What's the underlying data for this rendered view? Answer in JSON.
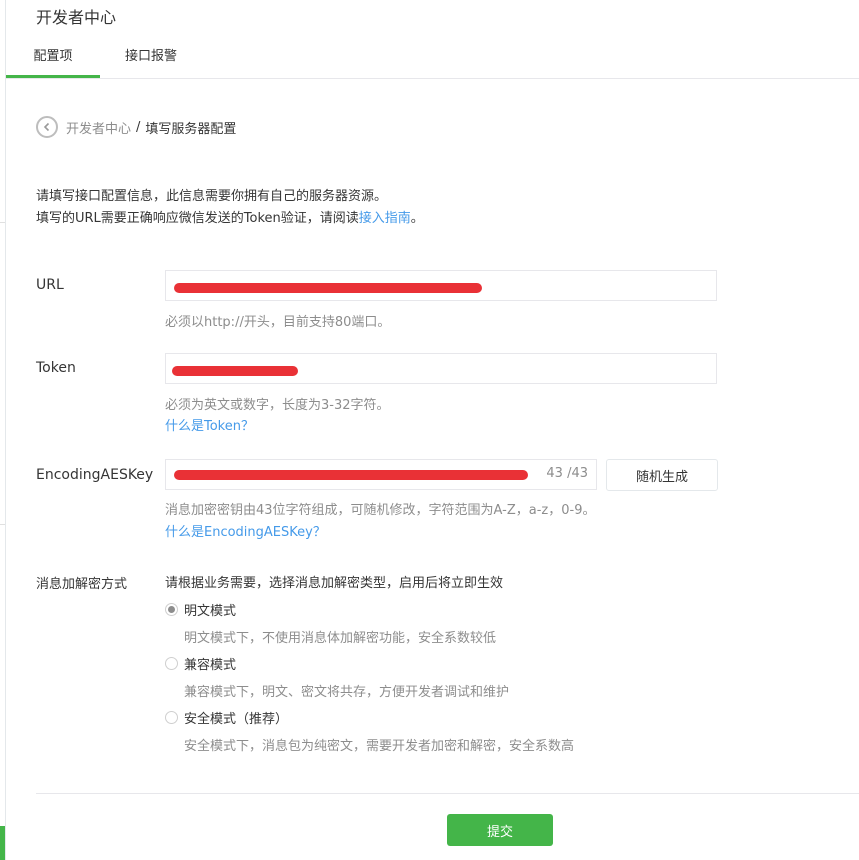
{
  "header": {
    "title": "开发者中心"
  },
  "tabs": [
    {
      "label": "配置项",
      "active": true
    },
    {
      "label": "接口报警",
      "active": false
    }
  ],
  "breadcrumb": {
    "parent": "开发者中心",
    "separator": "/",
    "current": "填写服务器配置"
  },
  "intro": {
    "line1": "请填写接口配置信息，此信息需要你拥有自己的服务器资源。",
    "line2_before": "填写的URL需要正确响应微信发送的Token验证，请阅读",
    "line2_link": "接入指南",
    "line2_after": "。"
  },
  "form": {
    "url": {
      "label": "URL",
      "hint": "必须以http://开头，目前支持80端口。"
    },
    "token": {
      "label": "Token",
      "hint": "必须为英文或数字，长度为3-32字符。",
      "help": "什么是Token？"
    },
    "aes": {
      "label": "EncodingAESKey",
      "counter": "43 /43",
      "random_button": "随机生成",
      "hint": "消息加密密钥由43位字符组成，可随机修改，字符范围为A-Z，a-z，0-9。",
      "help": "什么是EncodingAESKey？"
    },
    "mode": {
      "label": "消息加解密方式",
      "description": "请根据业务需要，选择消息加解密类型，启用后将立即生效",
      "options": [
        {
          "label": "明文模式",
          "desc": "明文模式下，不使用消息体加解密功能，安全系数较低",
          "checked": true
        },
        {
          "label": "兼容模式",
          "desc": "兼容模式下，明文、密文将共存，方便开发者调试和维护",
          "checked": false
        },
        {
          "label": "安全模式（推荐）",
          "desc": "安全模式下，消息包为纯密文，需要开发者加密和解密，安全系数高",
          "checked": false
        }
      ]
    }
  },
  "submit_label": "提交",
  "colors": {
    "accent": "#44b549",
    "link": "#459ae9",
    "muted": "#8d8d8d",
    "redaction": "#e8262b"
  }
}
